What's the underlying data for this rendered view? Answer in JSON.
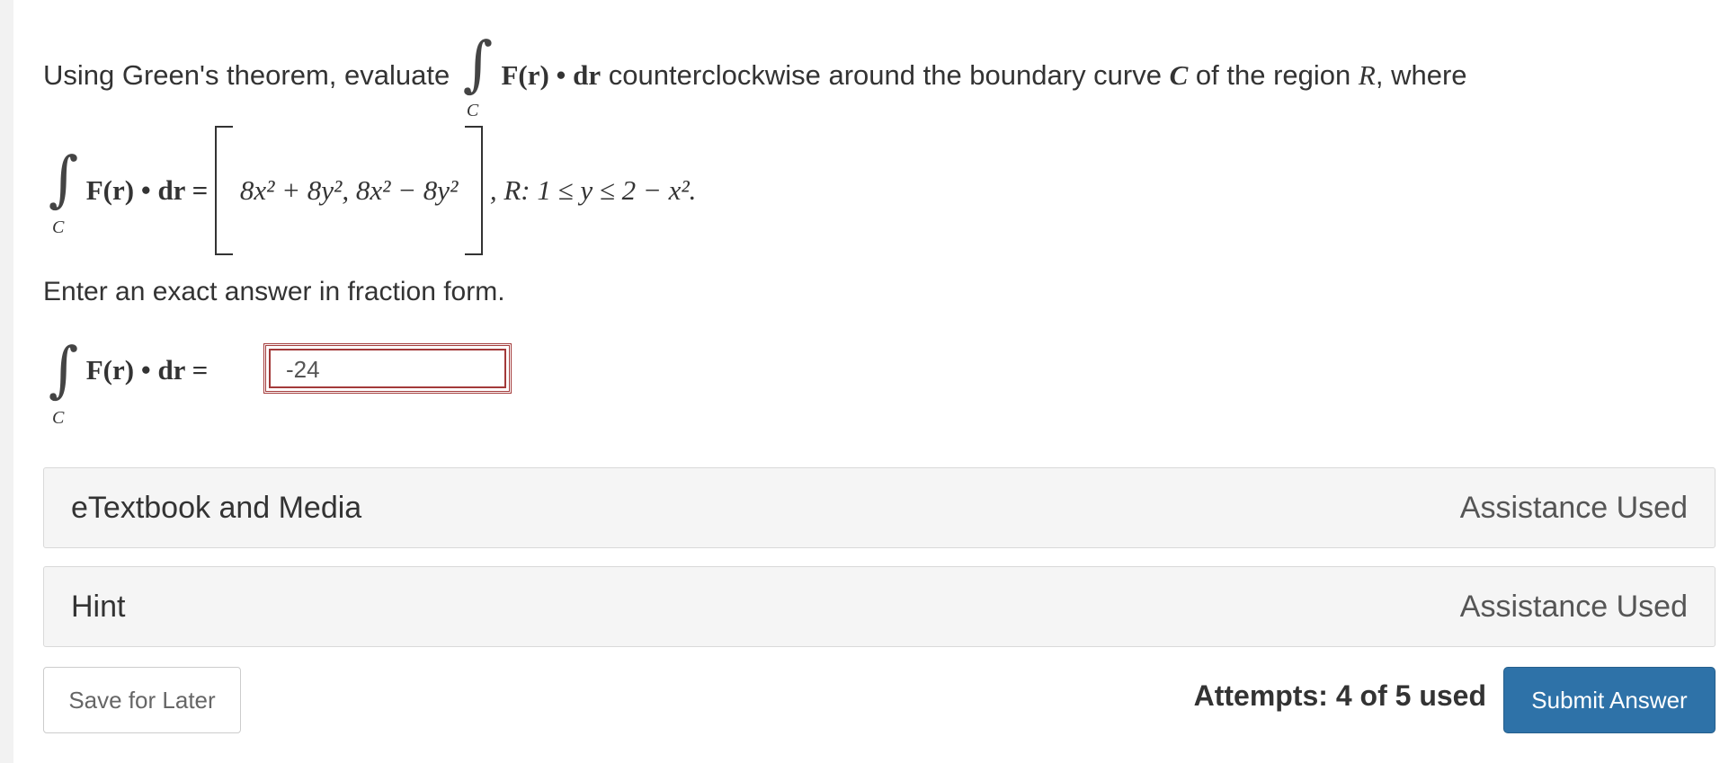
{
  "question": {
    "intro": "Using Green's theorem, evaluate",
    "integral_sub": "C",
    "integrand": "F(r) • dr",
    "middle": "counterclockwise around the boundary curve",
    "curve": "C",
    "of_region": "of the region",
    "region": "R",
    "where": ", where"
  },
  "definition": {
    "lhs": "F(r) • dr =",
    "vector": "8x² + 8y², 8x² − 8y²",
    "region": ", R: 1 ≤ y ≤ 2 − x²."
  },
  "instruction": "Enter an exact answer in fraction form.",
  "answer": {
    "lhs": "F(r) • dr =",
    "value": "-24"
  },
  "panels": [
    {
      "title": "eTextbook and Media",
      "status": "Assistance Used"
    },
    {
      "title": "Hint",
      "status": "Assistance Used"
    }
  ],
  "footer": {
    "save_label": "Save for Later",
    "attempts": "Attempts: 4 of 5 used",
    "submit_label": "Submit Answer"
  },
  "colors": {
    "submit_bg": "#2e72a8",
    "answer_border": "#a33a3a",
    "panel_bg": "#f5f5f5"
  }
}
